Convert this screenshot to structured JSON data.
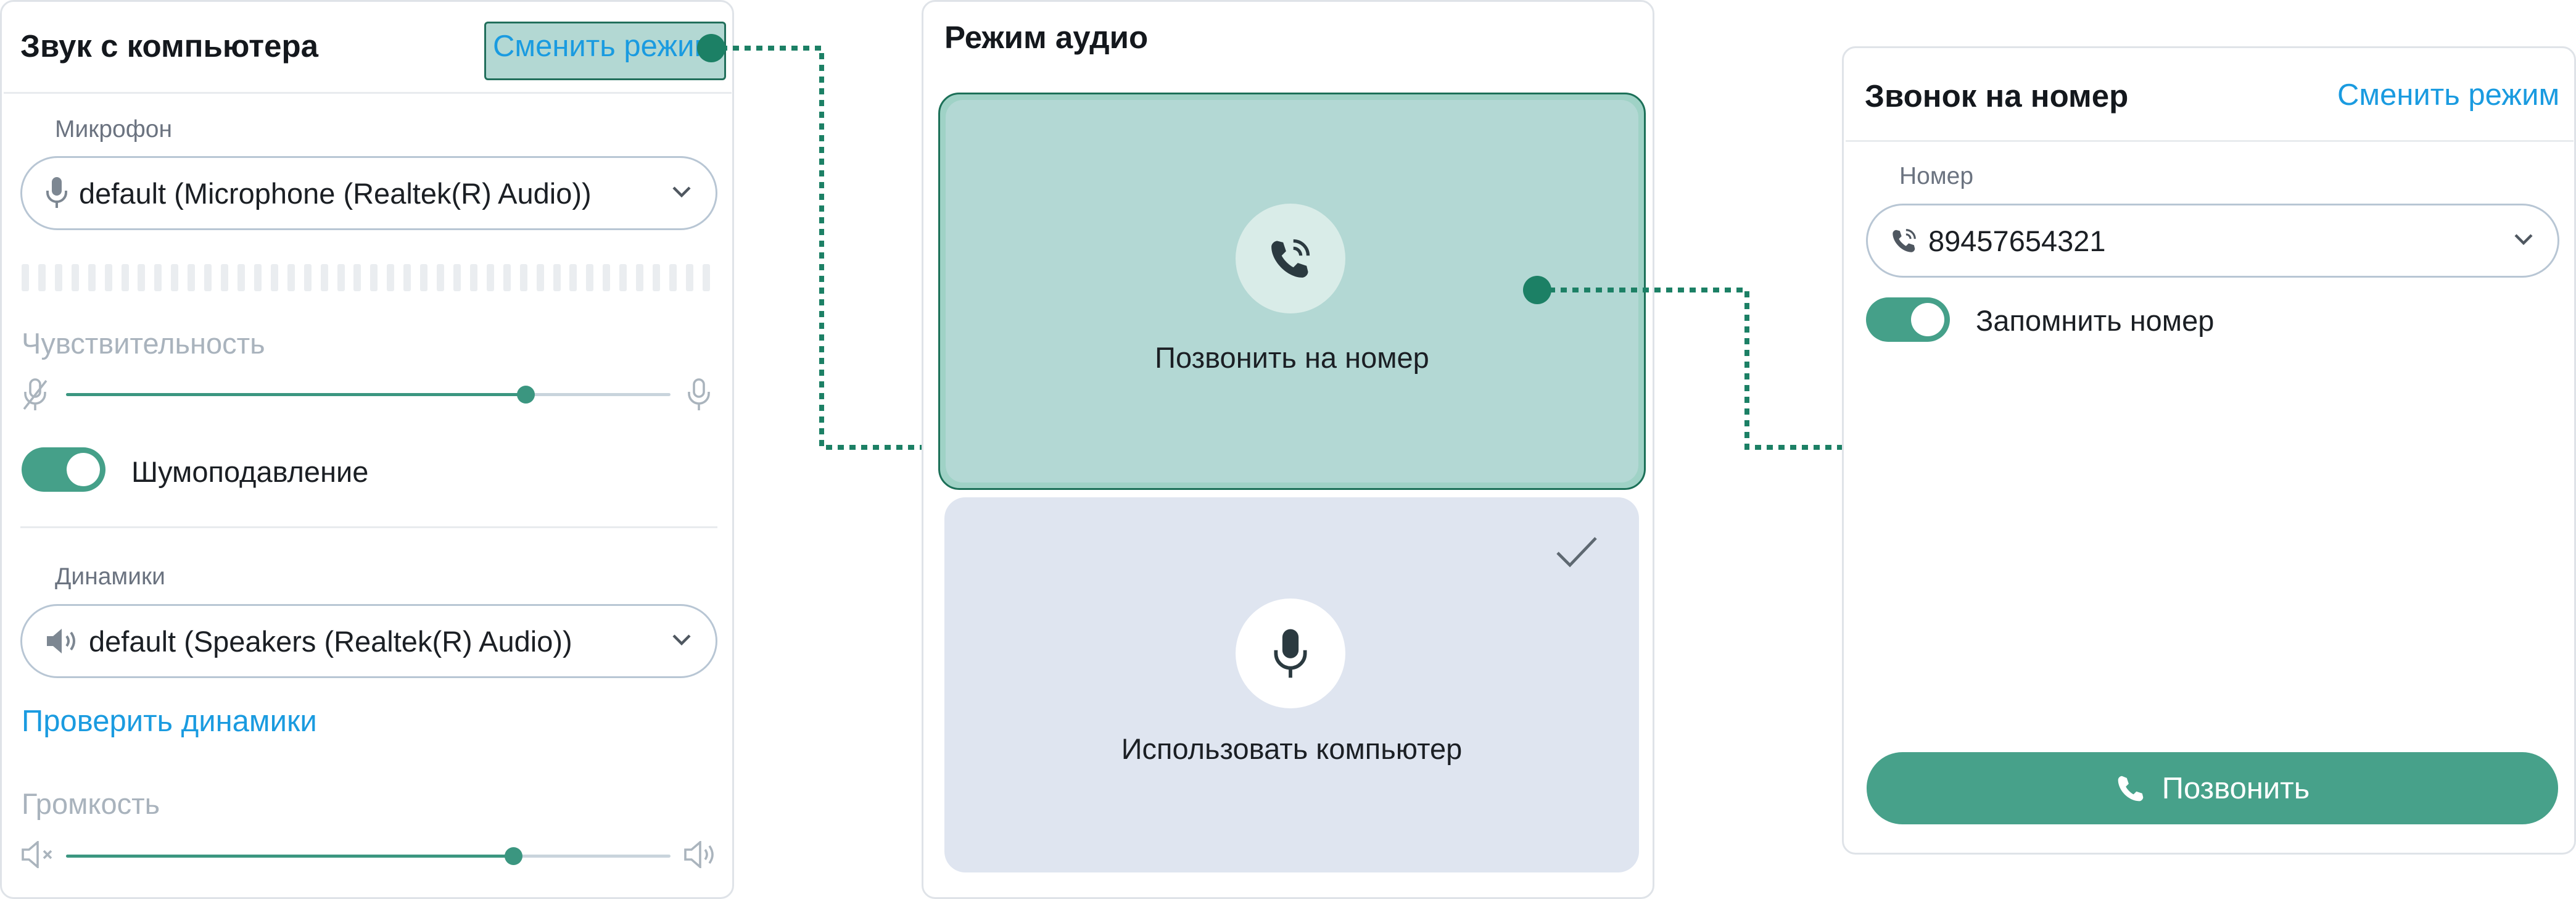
{
  "left_panel": {
    "title": "Звук с компьютера",
    "switch_mode": "Сменить режим",
    "mic_label": "Микрофон",
    "mic_value": "default (Microphone (Realtek(R) Audio))",
    "sensitivity_label": "Чувствительность",
    "sensitivity_level": 0.76,
    "noise_label": "Шумоподавление",
    "noise_on": true,
    "speakers_label": "Динамики",
    "speakers_value": "default (Speakers (Realtek(R) Audio))",
    "check_speakers": "Проверить динамики",
    "volume_label": "Громкость",
    "volume_level": 0.74
  },
  "middle_panel": {
    "title": "Режим аудио",
    "option_phone": "Позвонить на номер",
    "option_computer": "Использовать компьютер"
  },
  "right_panel": {
    "title": "Звонок на номер",
    "switch_mode": "Сменить режим",
    "number_label": "Номер",
    "number_value": "89457654321",
    "remember_label": "Запомнить номер",
    "remember_on": true,
    "call_button": "Позвонить"
  },
  "colors": {
    "accent_green": "#47a18a",
    "link_blue": "#1a9be0",
    "connector_green": "#1c8065",
    "card_computer_bg": "#dfe5f0",
    "card_phone_bg": "#b3d8d4"
  }
}
